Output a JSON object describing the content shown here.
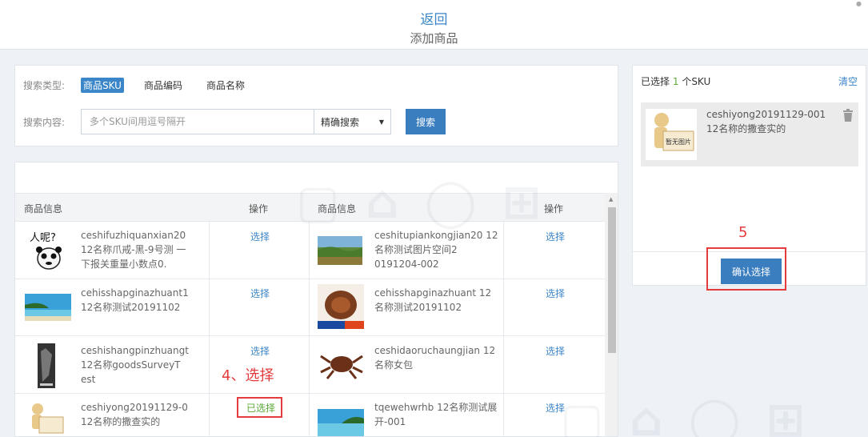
{
  "header": {
    "back": "返回",
    "title": "添加商品"
  },
  "search": {
    "type_label": "搜索类型:",
    "types": [
      "商品SKU",
      "商品编码",
      "商品名称"
    ],
    "content_label": "搜索内容:",
    "placeholder": "多个SKU间用逗号隔开",
    "mode": "精确搜索",
    "button": "搜索"
  },
  "table": {
    "col_info": "商品信息",
    "col_op": "操作",
    "rows": [
      {
        "left": {
          "name": "ceshifuzhiquanxian20 12名称爪戒-黑-9号测 一下报关重量小数点0.",
          "op": "选择"
        },
        "right": {
          "name": "ceshitupiankongjian20 12名称测试图片空间2 0191204-002",
          "op": "选择"
        }
      },
      {
        "left": {
          "name": "cehisshapginazhuant1 12名称测试20191102",
          "op": "选择"
        },
        "right": {
          "name": "cehisshapginazhuant 12名称测试20191102",
          "op": "选择"
        }
      },
      {
        "left": {
          "name": "ceshishangpinzhuangt 12名称goodsSurveyT est",
          "op": "选择"
        },
        "right": {
          "name": "ceshidaoruchaungjian 12名称女包",
          "op": "选择"
        }
      },
      {
        "left": {
          "name": "ceshiyong20191129-0 12名称的撒查实的",
          "op": "已选择"
        },
        "right": {
          "name": "tqewehwrhb 12名称测试展开-001",
          "op": "选择"
        }
      }
    ]
  },
  "selected": {
    "prefix": "已选择",
    "count": "1",
    "suffix": "个SKU",
    "clear": "清空",
    "item_name": "ceshiyong20191129-001",
    "item_desc": "12名称的撒查实的",
    "confirm": "确认选择"
  },
  "placeholder_image_text": "暂无图片",
  "annotations": {
    "step4": "4、选择",
    "step5": "5"
  },
  "colors": {
    "accent": "#3b86c8",
    "button": "#3b7ec0",
    "selected": "#5aab3a",
    "annotation": "#e43c3c"
  }
}
